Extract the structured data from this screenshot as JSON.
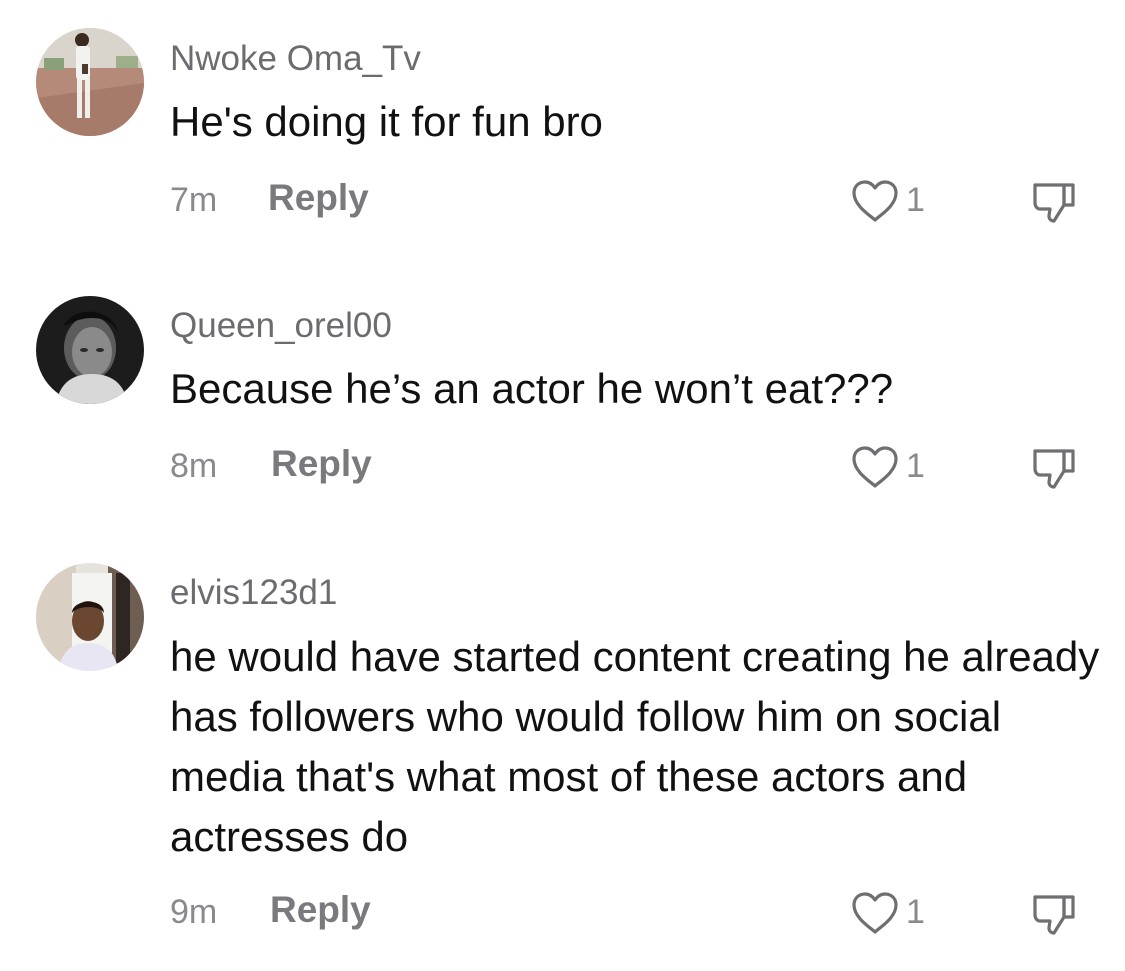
{
  "comments": [
    {
      "username": "Nwoke Oma_Tv",
      "text": "He's doing it for fun bro",
      "time": "7m",
      "reply_label": "Reply",
      "likes": "1",
      "avatar": "person-standing-outdoors-photo"
    },
    {
      "username": "Queen_orel00",
      "text": "Because he’s an actor he won’t eat???",
      "time": "8m",
      "reply_label": "Reply",
      "likes": "1",
      "avatar": "woman-portrait-bw-photo"
    },
    {
      "username": "elvis123d1",
      "text": "he would have started content creating he already has followers who would follow him on social media that's what most of these actors and actresses do",
      "time": "9m",
      "reply_label": "Reply",
      "likes": "1",
      "avatar": "man-portrait-photo"
    }
  ],
  "icons": {
    "like": "heart-outline-icon",
    "dislike": "thumbs-down-outline-icon"
  }
}
